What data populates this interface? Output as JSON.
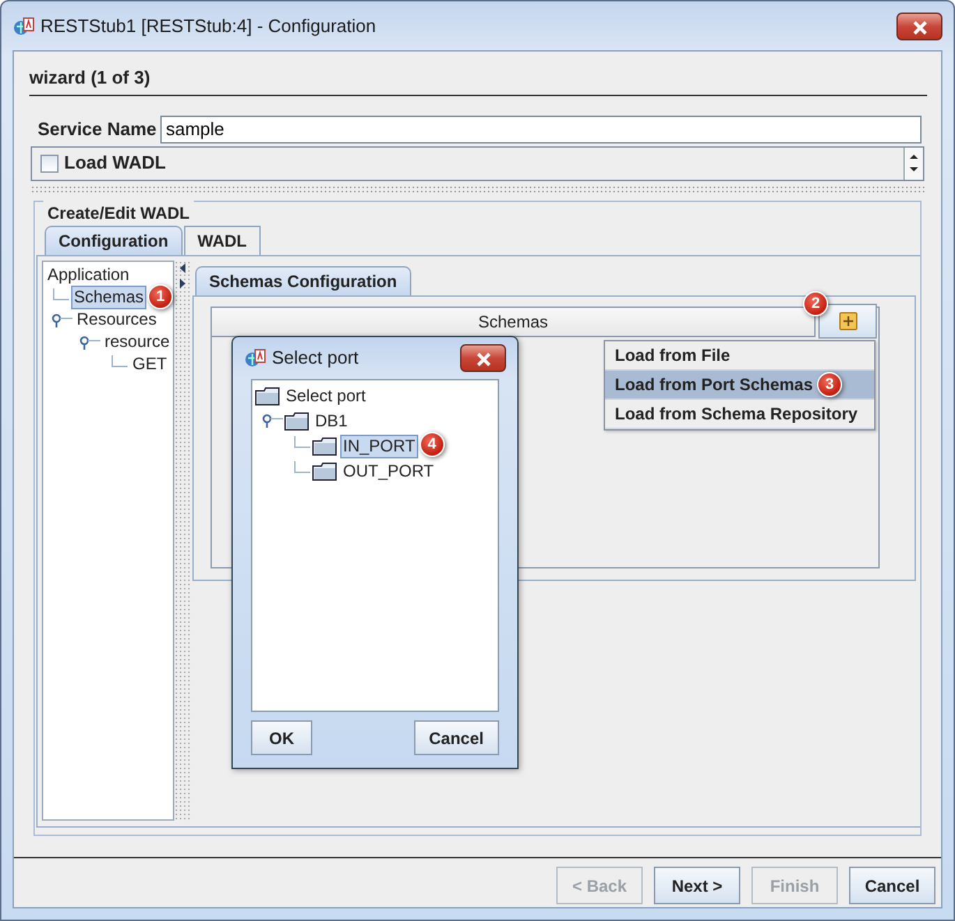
{
  "window": {
    "title": "RESTStub1 [RESTStub:4] - Configuration"
  },
  "wizard": {
    "heading": "wizard (1 of 3)"
  },
  "service_name": {
    "label": "Service Name",
    "value": "sample"
  },
  "load_wadl": {
    "label": "Load WADL",
    "checked": false
  },
  "group": {
    "title": "Create/Edit WADL"
  },
  "tabs": [
    {
      "label": "Configuration",
      "selected": true
    },
    {
      "label": "WADL",
      "selected": false
    }
  ],
  "tree": [
    {
      "label": "Application",
      "selected": false,
      "children": [
        {
          "label": "Schemas",
          "selected": true,
          "callout": "1"
        },
        {
          "label": "Resources",
          "selected": false,
          "expanded": true,
          "children": [
            {
              "label": "resource",
              "selected": false,
              "expanded": true,
              "children": [
                {
                  "label": "GET",
                  "selected": false
                }
              ]
            }
          ]
        }
      ]
    }
  ],
  "inner_tabs": [
    {
      "label": "Schemas Configuration",
      "selected": true
    }
  ],
  "schemas_table": {
    "columns": [
      "Schemas"
    ]
  },
  "add_button": {
    "callout": "2"
  },
  "add_menu": {
    "items": [
      {
        "label": "Load from File",
        "selected": false
      },
      {
        "label": "Load from Port Schemas",
        "selected": true,
        "callout": "3"
      },
      {
        "label": "Load from Schema Repository",
        "selected": false
      }
    ]
  },
  "select_port_dialog": {
    "title": "Select port",
    "tree": [
      {
        "label": "Select port",
        "selected": false,
        "children": [
          {
            "label": "DB1",
            "selected": false,
            "expanded": true,
            "children": [
              {
                "label": "IN_PORT",
                "selected": true,
                "callout": "4"
              },
              {
                "label": "OUT_PORT",
                "selected": false
              }
            ]
          }
        ]
      }
    ],
    "buttons": [
      "OK",
      "Cancel"
    ]
  },
  "buttons": [
    {
      "label": "< Back",
      "disabled": true
    },
    {
      "label": "Next >",
      "disabled": false
    },
    {
      "label": "Finish",
      "disabled": true
    },
    {
      "label": "Cancel",
      "disabled": false
    }
  ]
}
